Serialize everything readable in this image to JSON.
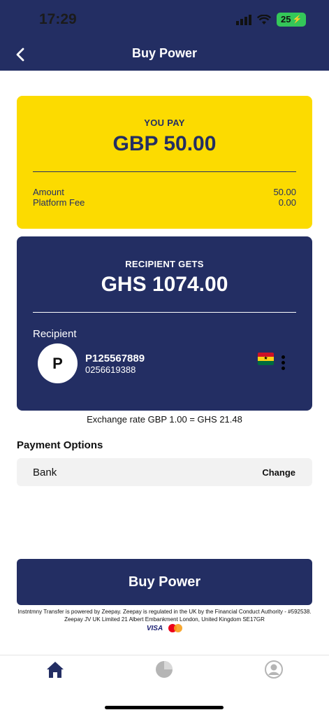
{
  "status_bar": {
    "time": "17:29",
    "battery": "25"
  },
  "header": {
    "title": "Buy Power"
  },
  "pay_card": {
    "label": "YOU PAY",
    "amount": "GBP 50.00",
    "rows": [
      {
        "label": "Amount",
        "value": "50.00"
      },
      {
        "label": "Platform Fee",
        "value": "0.00"
      }
    ]
  },
  "recipient_card": {
    "label": "RECIPIENT GETS",
    "amount": "GHS 1074.00",
    "heading": "Recipient",
    "avatar_initial": "P",
    "id": "P125567889",
    "phone": "0256619388",
    "flag_icon": "ghana-flag-icon"
  },
  "exchange_rate": "Exchange rate GBP 1.00 = GHS 21.48",
  "payment": {
    "title": "Payment Options",
    "method": "Bank",
    "change_label": "Change"
  },
  "buy_button": "Buy Power",
  "disclaimer": "Instntmny Transfer is powered by Zeepay. Zeepay is regulated in the UK by the Financial Conduct Authority - #592538. Zeepay JV UK Limited 21 Albert Embankment London, United Kingdom SE17GR",
  "card_logos": {
    "visa": "VISA",
    "mastercard": "mastercard-icon"
  },
  "tabs": [
    "home-icon",
    "pie-chart-icon",
    "profile-icon"
  ],
  "colors": {
    "primary": "#232e63",
    "accent": "#fcdb00",
    "battery": "#34c759"
  }
}
